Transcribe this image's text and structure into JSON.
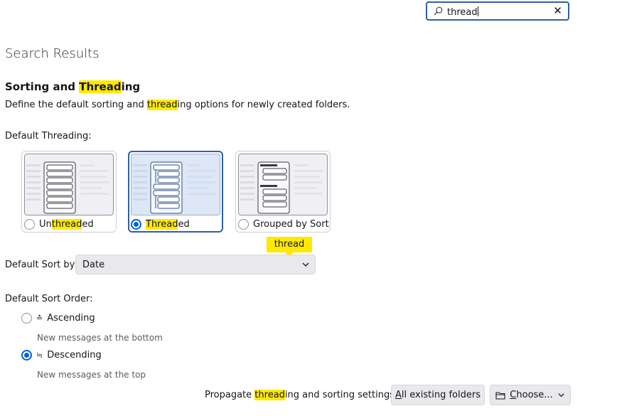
{
  "search": {
    "value": "thread"
  },
  "page": {
    "results_title": "Search Results",
    "section_title": {
      "pre": "Sorting and ",
      "hl": "Thread",
      "post": "ing"
    },
    "section_desc": {
      "pre": "Define the default sorting and ",
      "hl": "thread",
      "post": "ing options for newly created folders."
    }
  },
  "threading": {
    "label": "Default Threading:",
    "options": [
      {
        "pre": "Un",
        "hl": "thread",
        "post": "ed",
        "selected": false
      },
      {
        "pre": "",
        "hl": "Thread",
        "post": "ed",
        "selected": true
      },
      {
        "pre": "Grouped by Sort",
        "hl": "",
        "post": "",
        "selected": false
      }
    ]
  },
  "tooltip": "thread",
  "sort_by": {
    "label": "Default Sort by:",
    "value": "Date"
  },
  "sort_order": {
    "label": "Default Sort Order:",
    "ascending": {
      "label": "Ascending",
      "desc": "New messages at the bottom",
      "selected": false
    },
    "descending": {
      "label": "Descending",
      "desc": "New messages at the top",
      "selected": true
    }
  },
  "propagate": {
    "label": {
      "pre": "Propagate ",
      "hl": "thread",
      "post": "ing and sorting settings to:"
    },
    "all_folders": {
      "access": "A",
      "rest": "ll existing folders"
    },
    "choose": {
      "access": "C",
      "rest": "hoose..."
    }
  },
  "colors": {
    "accent": "#0061e0",
    "focus": "#2f5fa8",
    "highlight": "#ffe900"
  }
}
